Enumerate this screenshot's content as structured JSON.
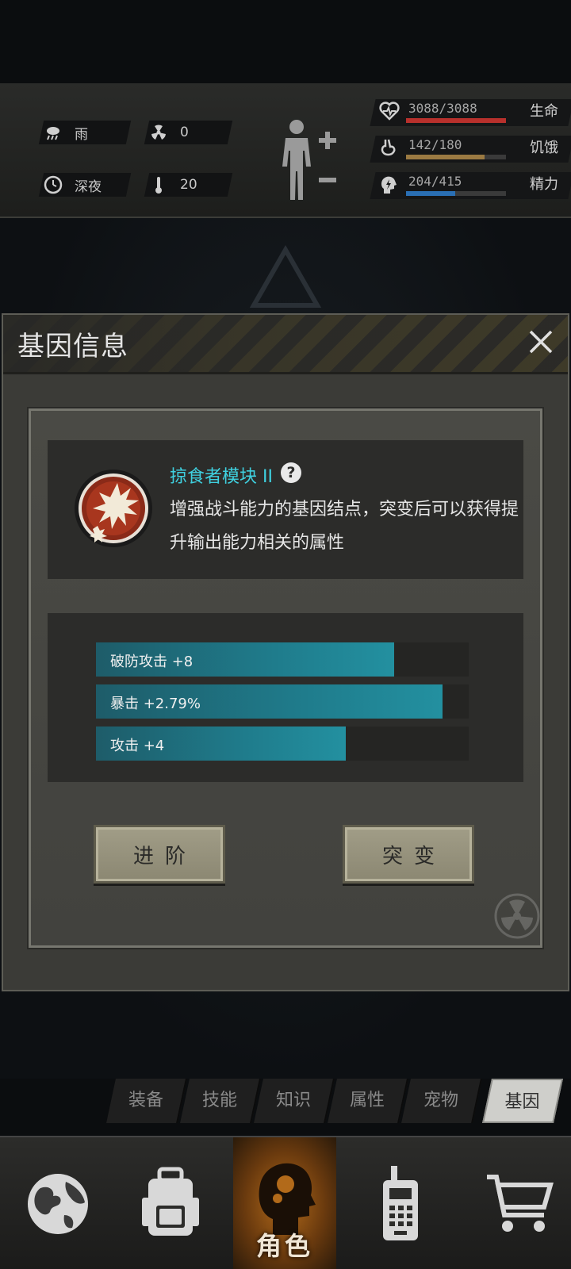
{
  "hud": {
    "weather": {
      "icon": "rain-cloud-icon",
      "label": "雨"
    },
    "radiation": {
      "icon": "radiation-icon",
      "value": "0"
    },
    "time": {
      "icon": "clock-icon",
      "label": "深夜"
    },
    "temperature": {
      "icon": "thermometer-icon",
      "value": "20"
    },
    "stats": [
      {
        "icon": "heart-pulse-icon",
        "value": "3088/3088",
        "label": "生命",
        "fraction": 1.0,
        "color": "#b8302c"
      },
      {
        "icon": "stomach-icon",
        "value": "142/180",
        "label": "饥饿",
        "fraction": 0.789,
        "color": "#9b7a42"
      },
      {
        "icon": "head-energy-icon",
        "value": "204/415",
        "label": "精力",
        "fraction": 0.492,
        "color": "#2a6fb4"
      }
    ]
  },
  "dialog": {
    "title": "基因信息",
    "gene": {
      "name": "掠食者模块 II",
      "description": "增强战斗能力的基因结点，突变后可以获得提升输出能力相关的属性"
    },
    "stats": [
      {
        "text": "破防攻击 +8",
        "fraction": 0.8
      },
      {
        "text": "暴击 +2.79%",
        "fraction": 0.93
      },
      {
        "text": "攻击 +4",
        "fraction": 0.67
      }
    ],
    "buttons": {
      "advance": "进阶",
      "mutate": "突变"
    }
  },
  "tabs": [
    "装备",
    "技能",
    "知识",
    "属性",
    "宠物",
    "基因"
  ],
  "active_tab": "基因",
  "nav": {
    "items": [
      "globe-icon",
      "backpack-icon",
      "character-head-icon",
      "walkie-talkie-icon",
      "shopping-cart-icon"
    ],
    "active_label": "角色"
  },
  "colors": {
    "accent": "#3fd1e0",
    "bar_fill": "#1f7c8c",
    "active_nav": "#b26a1a"
  }
}
